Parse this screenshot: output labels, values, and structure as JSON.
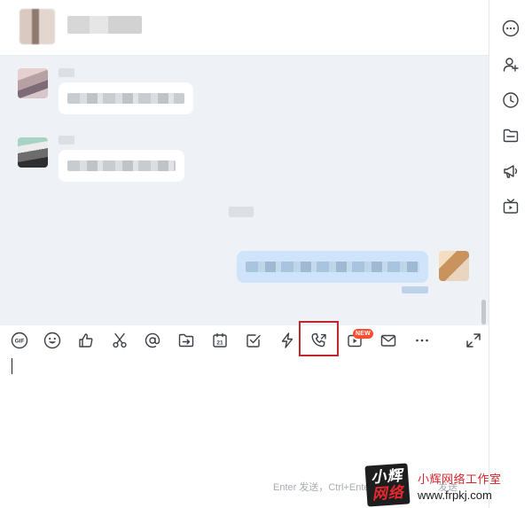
{
  "toolbar": {
    "gif_label": "GIF",
    "new_badge": "NEW",
    "calendar_day": "21"
  },
  "composer": {
    "send_hint": "Enter 发送，Ctrl+Enter 换行",
    "send_button": "发送"
  },
  "watermark": {
    "logo_top": "小辉",
    "logo_bottom": "网络",
    "title": "小辉网络工作室",
    "url": "www.frpkj.com"
  },
  "icons": {
    "toolbar": [
      "gif-icon",
      "emoji-icon",
      "thumbs-up-icon",
      "scissors-icon",
      "at-icon",
      "folder-transfer-icon",
      "calendar-icon",
      "checkbox-icon",
      "lightning-icon",
      "phone-call-icon",
      "video-play-icon",
      "mail-icon",
      "more-icon",
      "expand-icon"
    ],
    "sidebar": [
      "more-circle-icon",
      "add-user-icon",
      "clock-icon",
      "folder-icon",
      "megaphone-icon",
      "tv-icon"
    ]
  },
  "colors": {
    "highlight_box": "#c0272d",
    "new_badge": "#ff4d2e",
    "outgoing_bubble": "#cfe4fb",
    "message_bg": "#eef1f5"
  }
}
